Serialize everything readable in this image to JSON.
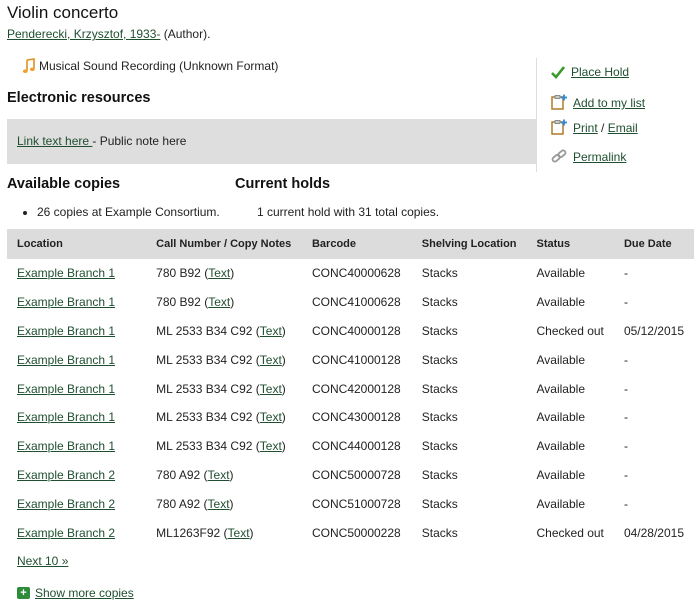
{
  "record": {
    "title": "Violin concerto",
    "author_link": "Penderecki, Krzysztof, 1933-",
    "author_role": " (Author).",
    "format": "Musical Sound Recording (Unknown Format)"
  },
  "electronic": {
    "heading": "Electronic resources",
    "link_text": "Link text here ",
    "note": "- Public note here"
  },
  "sidebar": {
    "place_hold": "Place Hold",
    "add_to_list": "Add to my list",
    "print": "Print",
    "separator": " / ",
    "email": "Email",
    "permalink": "Permalink"
  },
  "availability": {
    "heading": "Available copies",
    "summary": "26 copies at Example Consortium.",
    "holds_heading": "Current holds",
    "holds_summary": "1 current hold with 31 total copies."
  },
  "copies_table": {
    "headers": [
      "Location",
      "Call Number / Copy Notes",
      "Barcode",
      "Shelving Location",
      "Status",
      "Due Date"
    ],
    "rows": [
      {
        "location": "Example Branch 1",
        "call": "780 B92",
        "barcode": "CONC40000628",
        "shelf": "Stacks",
        "status": "Available",
        "due": "-"
      },
      {
        "location": "Example Branch 1",
        "call": "780 B92",
        "barcode": "CONC41000628",
        "shelf": "Stacks",
        "status": "Available",
        "due": "-"
      },
      {
        "location": "Example Branch 1",
        "call": "ML 2533 B34 C92",
        "barcode": "CONC40000128",
        "shelf": "Stacks",
        "status": "Checked out",
        "due": "05/12/2015"
      },
      {
        "location": "Example Branch 1",
        "call": "ML 2533 B34 C92",
        "barcode": "CONC41000128",
        "shelf": "Stacks",
        "status": "Available",
        "due": "-"
      },
      {
        "location": "Example Branch 1",
        "call": "ML 2533 B34 C92",
        "barcode": "CONC42000128",
        "shelf": "Stacks",
        "status": "Available",
        "due": "-"
      },
      {
        "location": "Example Branch 1",
        "call": "ML 2533 B34 C92",
        "barcode": "CONC43000128",
        "shelf": "Stacks",
        "status": "Available",
        "due": "-"
      },
      {
        "location": "Example Branch 1",
        "call": "ML 2533 B34 C92",
        "barcode": "CONC44000128",
        "shelf": "Stacks",
        "status": "Available",
        "due": "-"
      },
      {
        "location": "Example Branch 2",
        "call": "780 A92",
        "barcode": "CONC50000728",
        "shelf": "Stacks",
        "status": "Available",
        "due": "-"
      },
      {
        "location": "Example Branch 2",
        "call": "780 A92",
        "barcode": "CONC51000728",
        "shelf": "Stacks",
        "status": "Available",
        "due": "-"
      },
      {
        "location": "Example Branch 2",
        "call": "ML1263F92",
        "barcode": "CONC50000228",
        "shelf": "Stacks",
        "status": "Checked out",
        "due": "04/28/2015"
      }
    ],
    "text_link": "Text"
  },
  "pager": {
    "next": "Next 10 »",
    "show_more": "Show more copies"
  },
  "icons": {
    "format": "music-note-icon",
    "place_hold": "checkmark-icon",
    "add_to_list": "clipboard-add-icon",
    "print": "clipboard-add-icon",
    "permalink": "chain-link-icon",
    "show_more": "plus-icon"
  },
  "colors": {
    "link": "#1f4f2f",
    "header_bg": "#dcdcdc",
    "note_box_bg": "#dedede",
    "check": "#3a9a2a"
  }
}
